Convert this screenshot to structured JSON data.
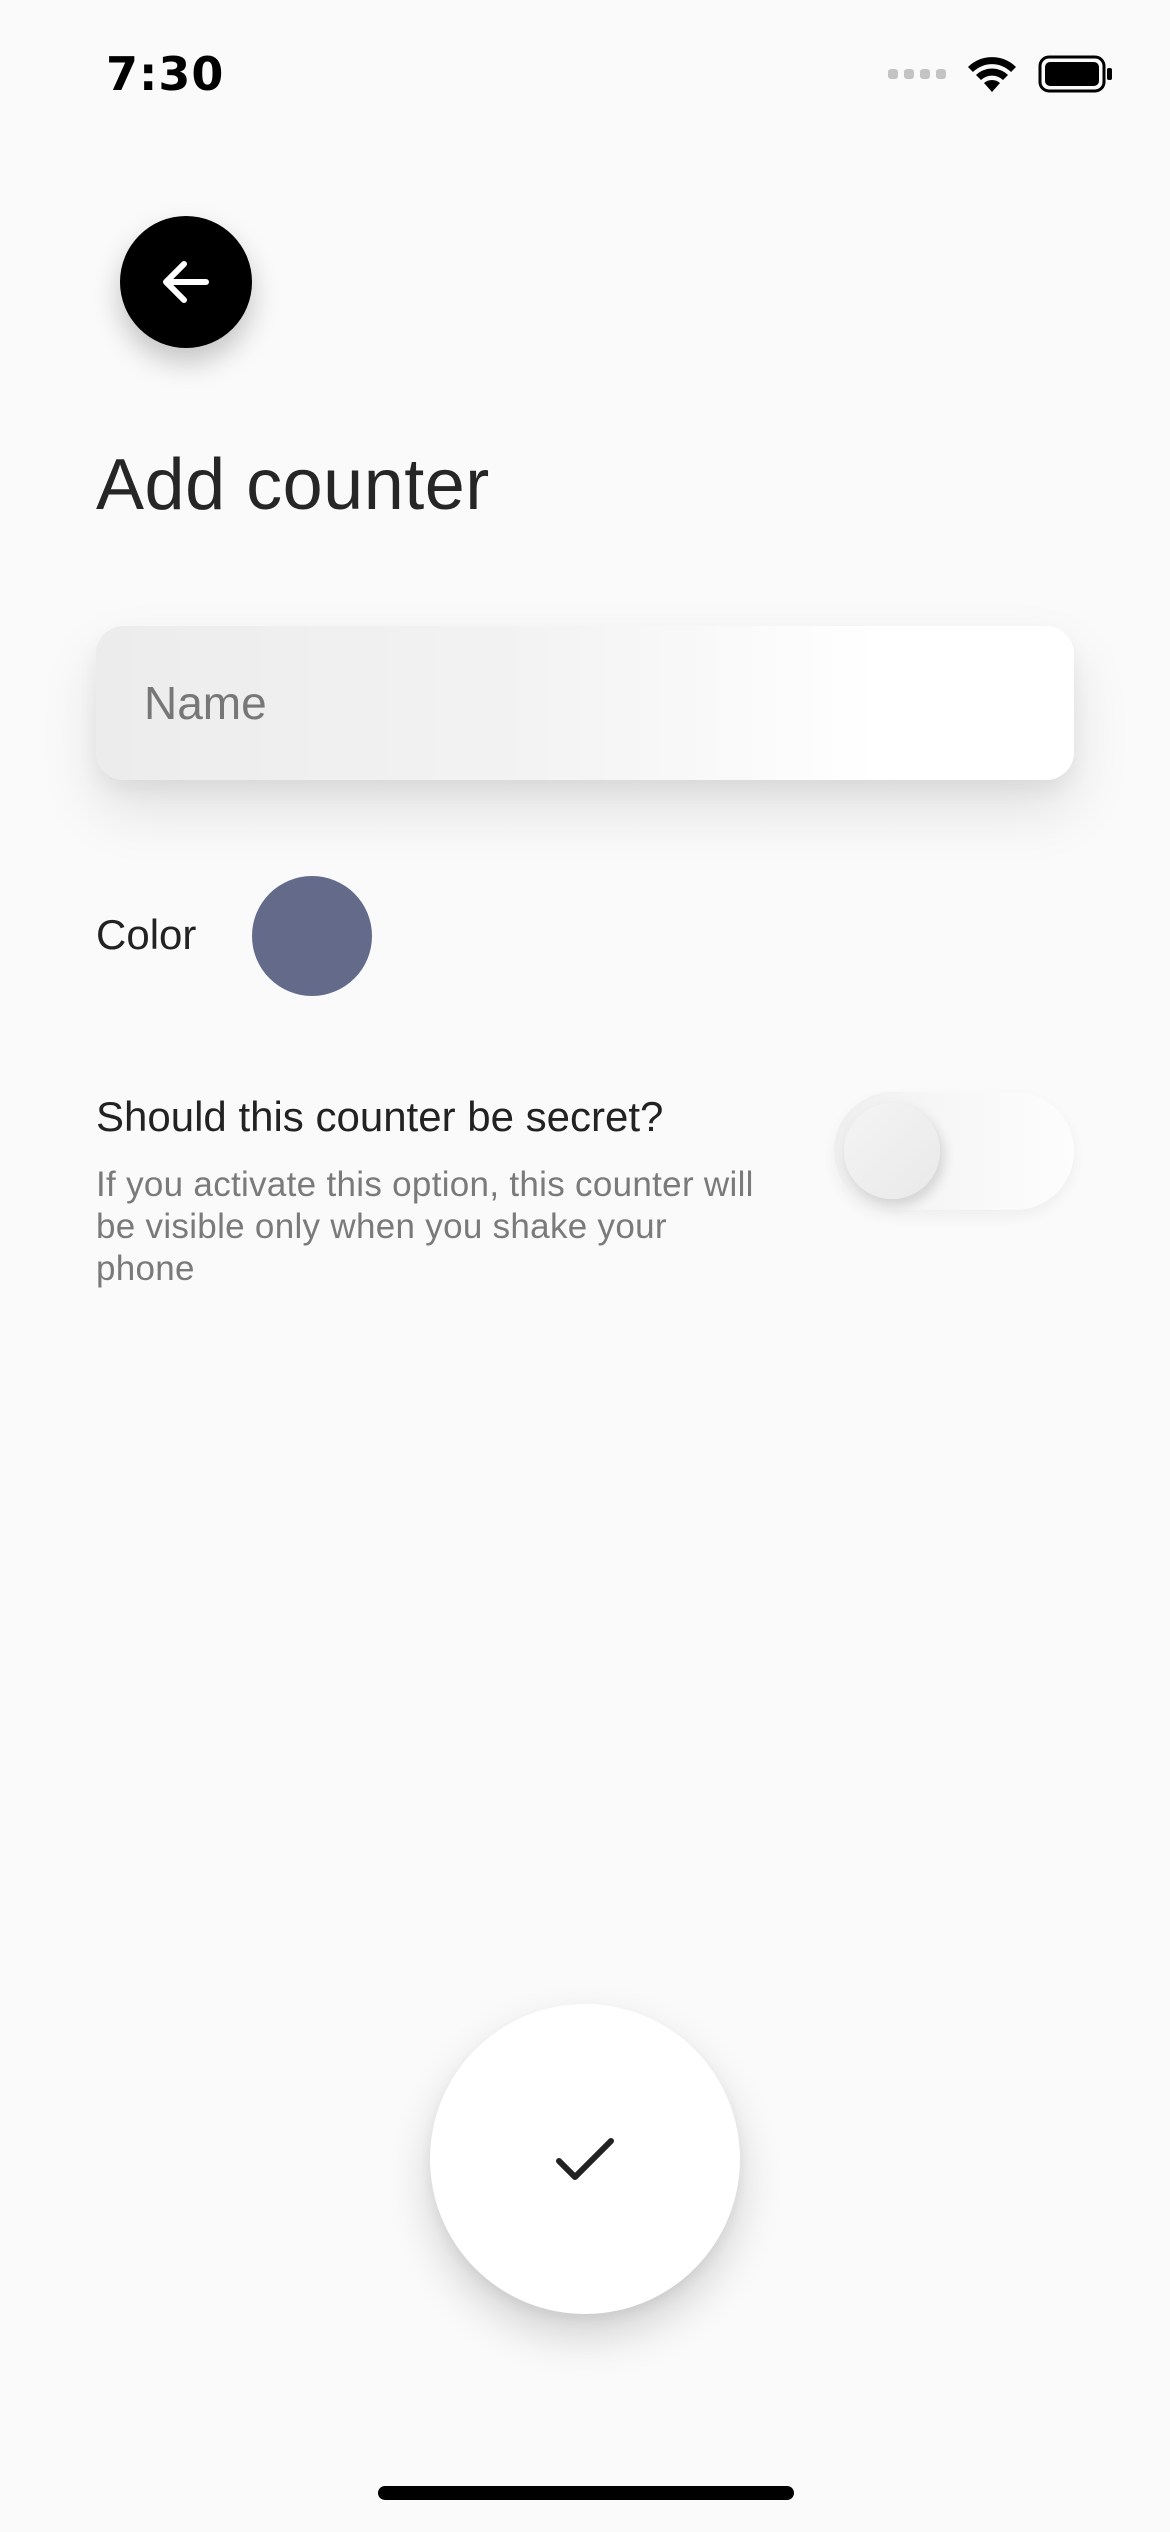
{
  "status_bar": {
    "time": "7:30",
    "icons": [
      "cellular-signal-icon",
      "wifi-icon",
      "battery-icon"
    ]
  },
  "header": {
    "back_icon": "arrow-left-icon",
    "title": "Add counter"
  },
  "form": {
    "name_placeholder": "Name",
    "name_value": "",
    "color_label": "Color",
    "selected_color": "#636A8A",
    "secret_title": "Should this counter be secret?",
    "secret_description": "If you activate this option, this counter will be visible only when you shake your phone",
    "secret_enabled": false
  },
  "actions": {
    "confirm_icon": "checkmark-icon"
  },
  "colors": {
    "background": "#fafafa",
    "back_button": "#000000",
    "text_primary": "#222222",
    "text_secondary": "#7a7a7a"
  }
}
